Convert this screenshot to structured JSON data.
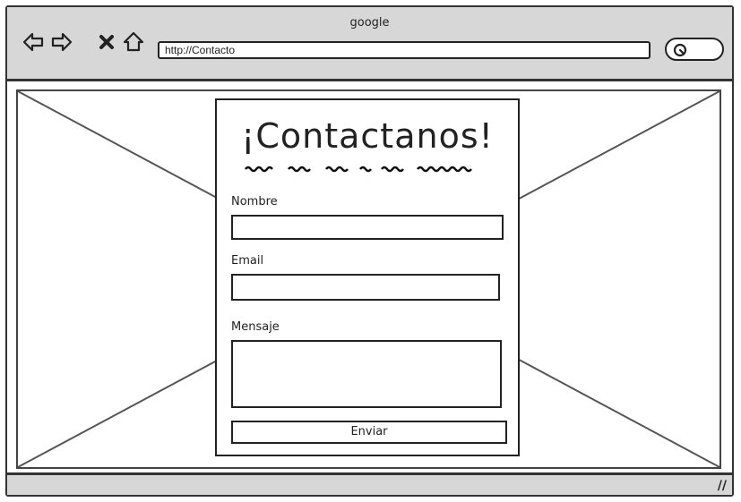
{
  "window": {
    "title": "google"
  },
  "toolbar": {
    "back_icon": "arrow-left-icon",
    "forward_icon": "arrow-right-icon",
    "stop_icon": "close-icon",
    "home_icon": "home-icon",
    "search_icon": "search-icon",
    "address_value": "http://Contacto"
  },
  "form": {
    "title": "¡Contactanos!",
    "fields": [
      {
        "label": "Nombre",
        "value": ""
      },
      {
        "label": "Email",
        "value": ""
      },
      {
        "label": "Mensaje",
        "value": ""
      }
    ],
    "submit_label": "Enviar"
  },
  "colors": {
    "chrome": "#d7d7d7",
    "border": "#222222"
  }
}
